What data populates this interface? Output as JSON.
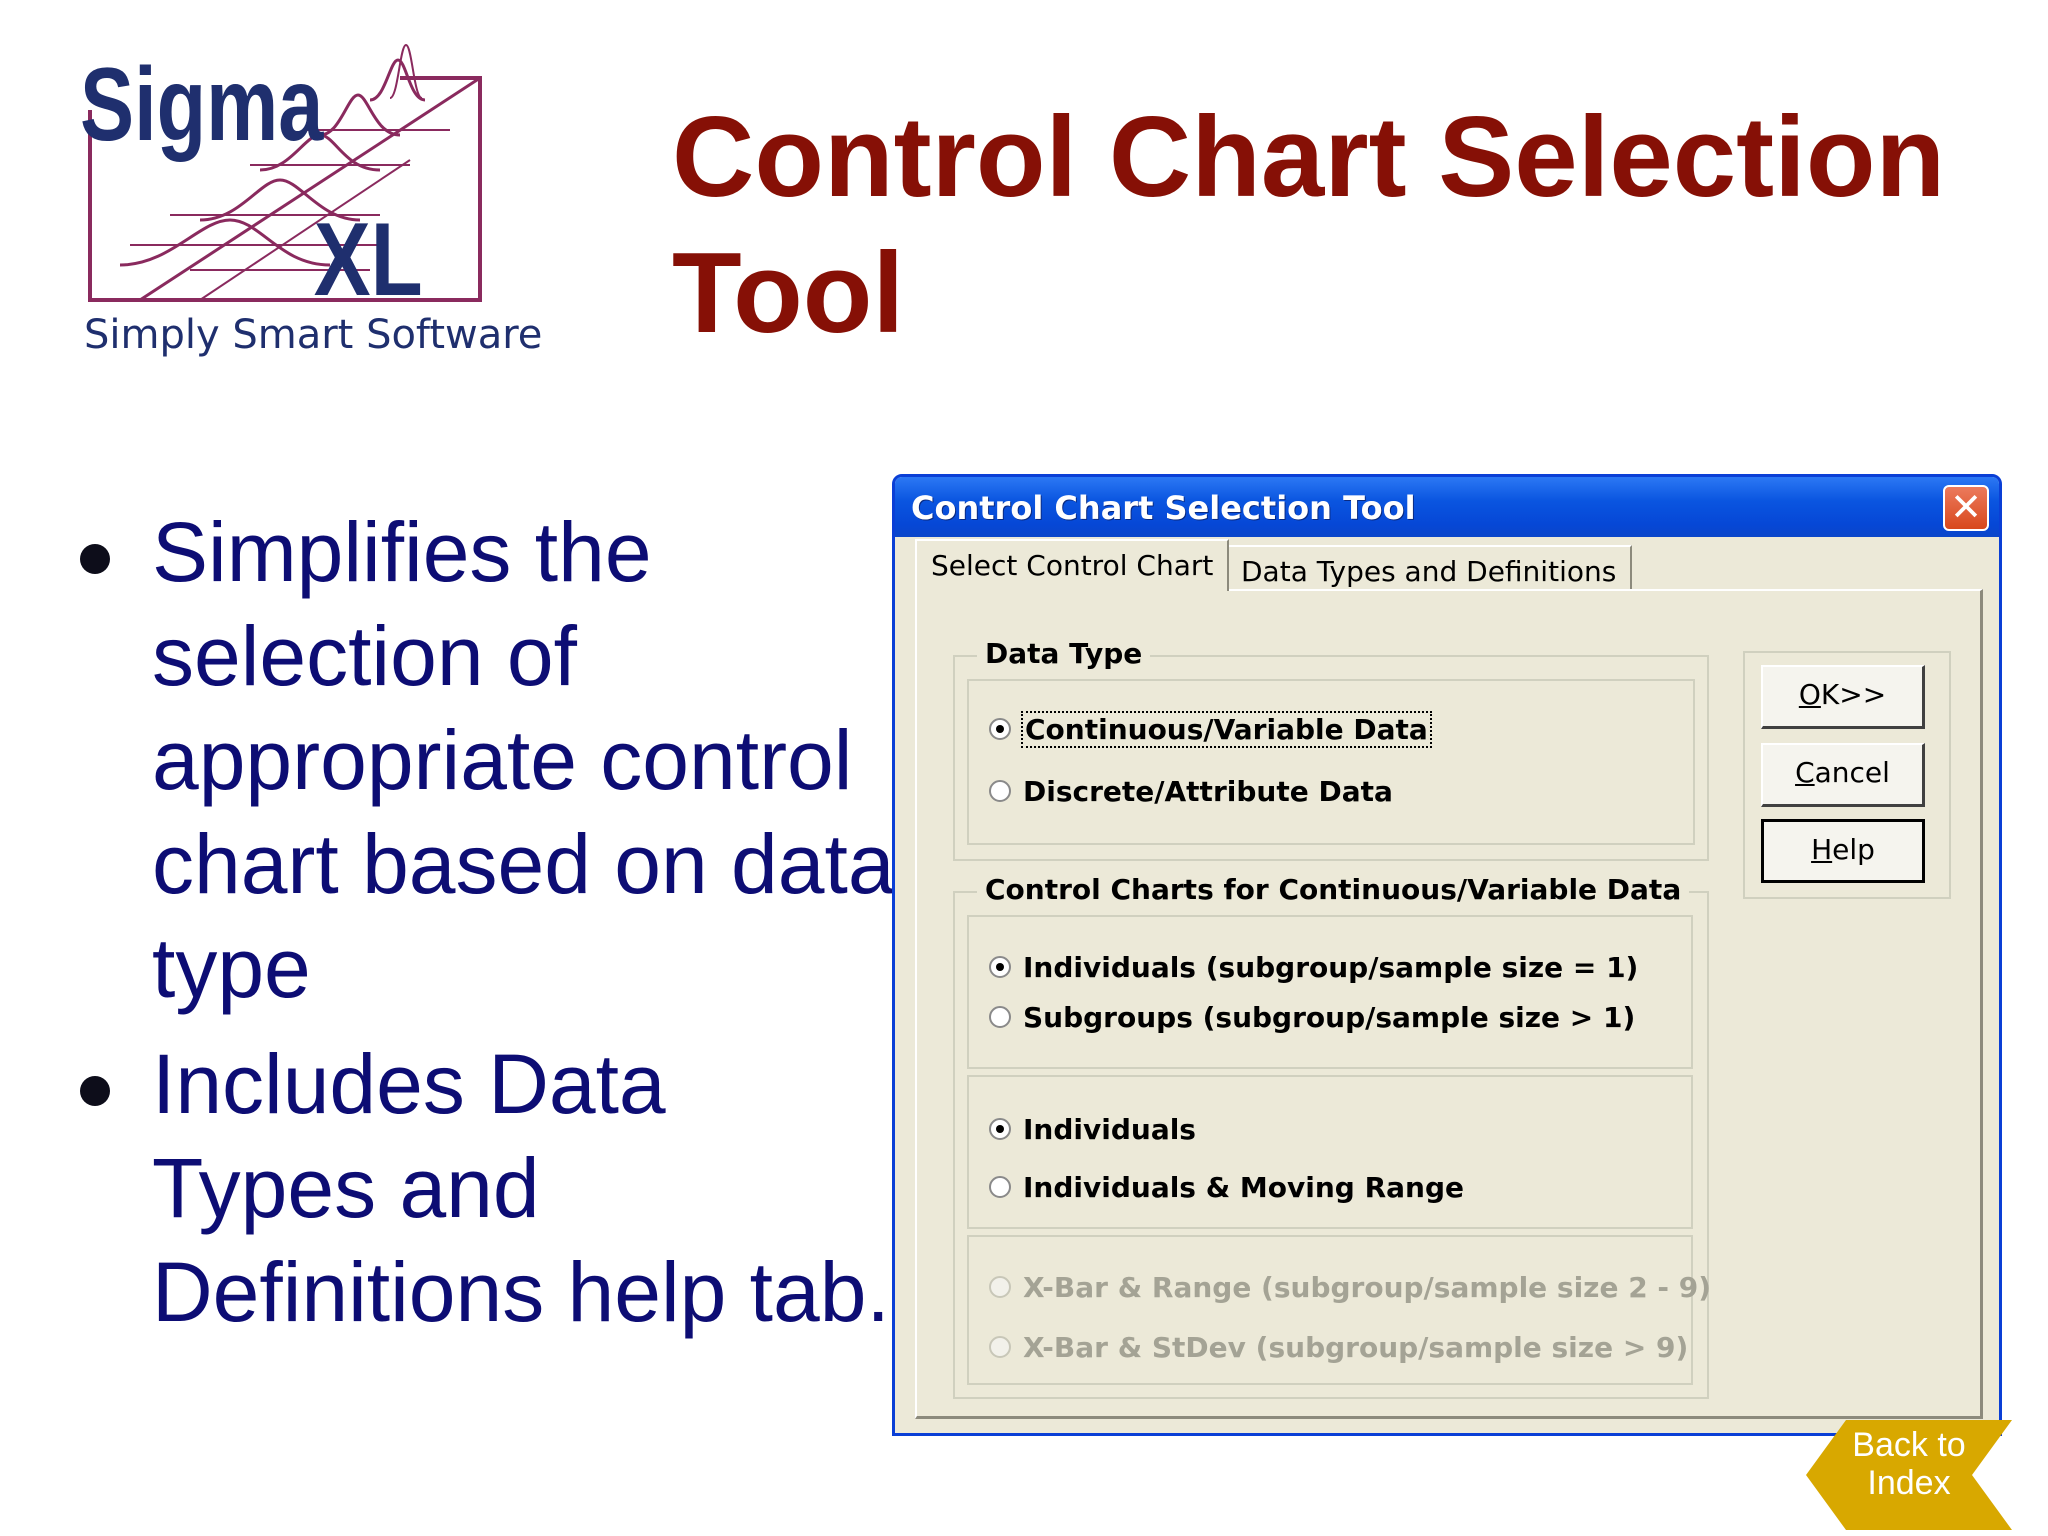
{
  "logo": {
    "brand_top": "Sigma",
    "brand_bottom": "XL",
    "tagline": "Simply Smart Software"
  },
  "slide": {
    "title": "Control Chart Selection Tool",
    "bullets": [
      "Simplifies the selection of appropriate control chart based on data type",
      "Includes Data Types and Definitions help tab."
    ]
  },
  "dialog": {
    "title": "Control Chart Selection Tool",
    "close_label": "✕",
    "tabs": [
      {
        "label": "Select Control Chart",
        "selected": true
      },
      {
        "label": "Data Types and Definitions",
        "selected": false
      }
    ],
    "data_type": {
      "legend": "Data Type",
      "options": [
        {
          "label": "Continuous/Variable Data",
          "checked": true
        },
        {
          "label": "Discrete/Attribute Data",
          "checked": false
        }
      ]
    },
    "continuous_charts": {
      "legend": "Control Charts for Continuous/Variable Data",
      "subgroup_options": [
        {
          "label": "Individuals (subgroup/sample size = 1)",
          "checked": true
        },
        {
          "label": "Subgroups (subgroup/sample size > 1)",
          "checked": false
        }
      ],
      "individuals_options": [
        {
          "label": "Individuals",
          "checked": true
        },
        {
          "label": "Individuals & Moving Range",
          "checked": false
        }
      ],
      "subgroup_chart_options": [
        {
          "label": "X-Bar & Range (subgroup/sample size 2 - 9)",
          "checked": false,
          "enabled": false
        },
        {
          "label": "X-Bar & StDev (subgroup/sample size > 9)",
          "checked": false,
          "enabled": false
        }
      ]
    },
    "buttons": {
      "ok_mnemonic": "O",
      "ok_rest": "K>>",
      "cancel_mnemonic": "C",
      "cancel_rest": "ancel",
      "help_mnemonic": "H",
      "help_rest": "elp"
    }
  },
  "back_to_index": {
    "line1": "Back to",
    "line2": "Index"
  },
  "colors": {
    "title": "#861006",
    "bullet_text": "#0d0d74",
    "dialog_face": "#ece9d8",
    "titlebar": "#0a55e0",
    "logo_purple": "#8a2a5e",
    "logo_navy": "#1f2f6e",
    "back_gold": "#d8a800"
  }
}
